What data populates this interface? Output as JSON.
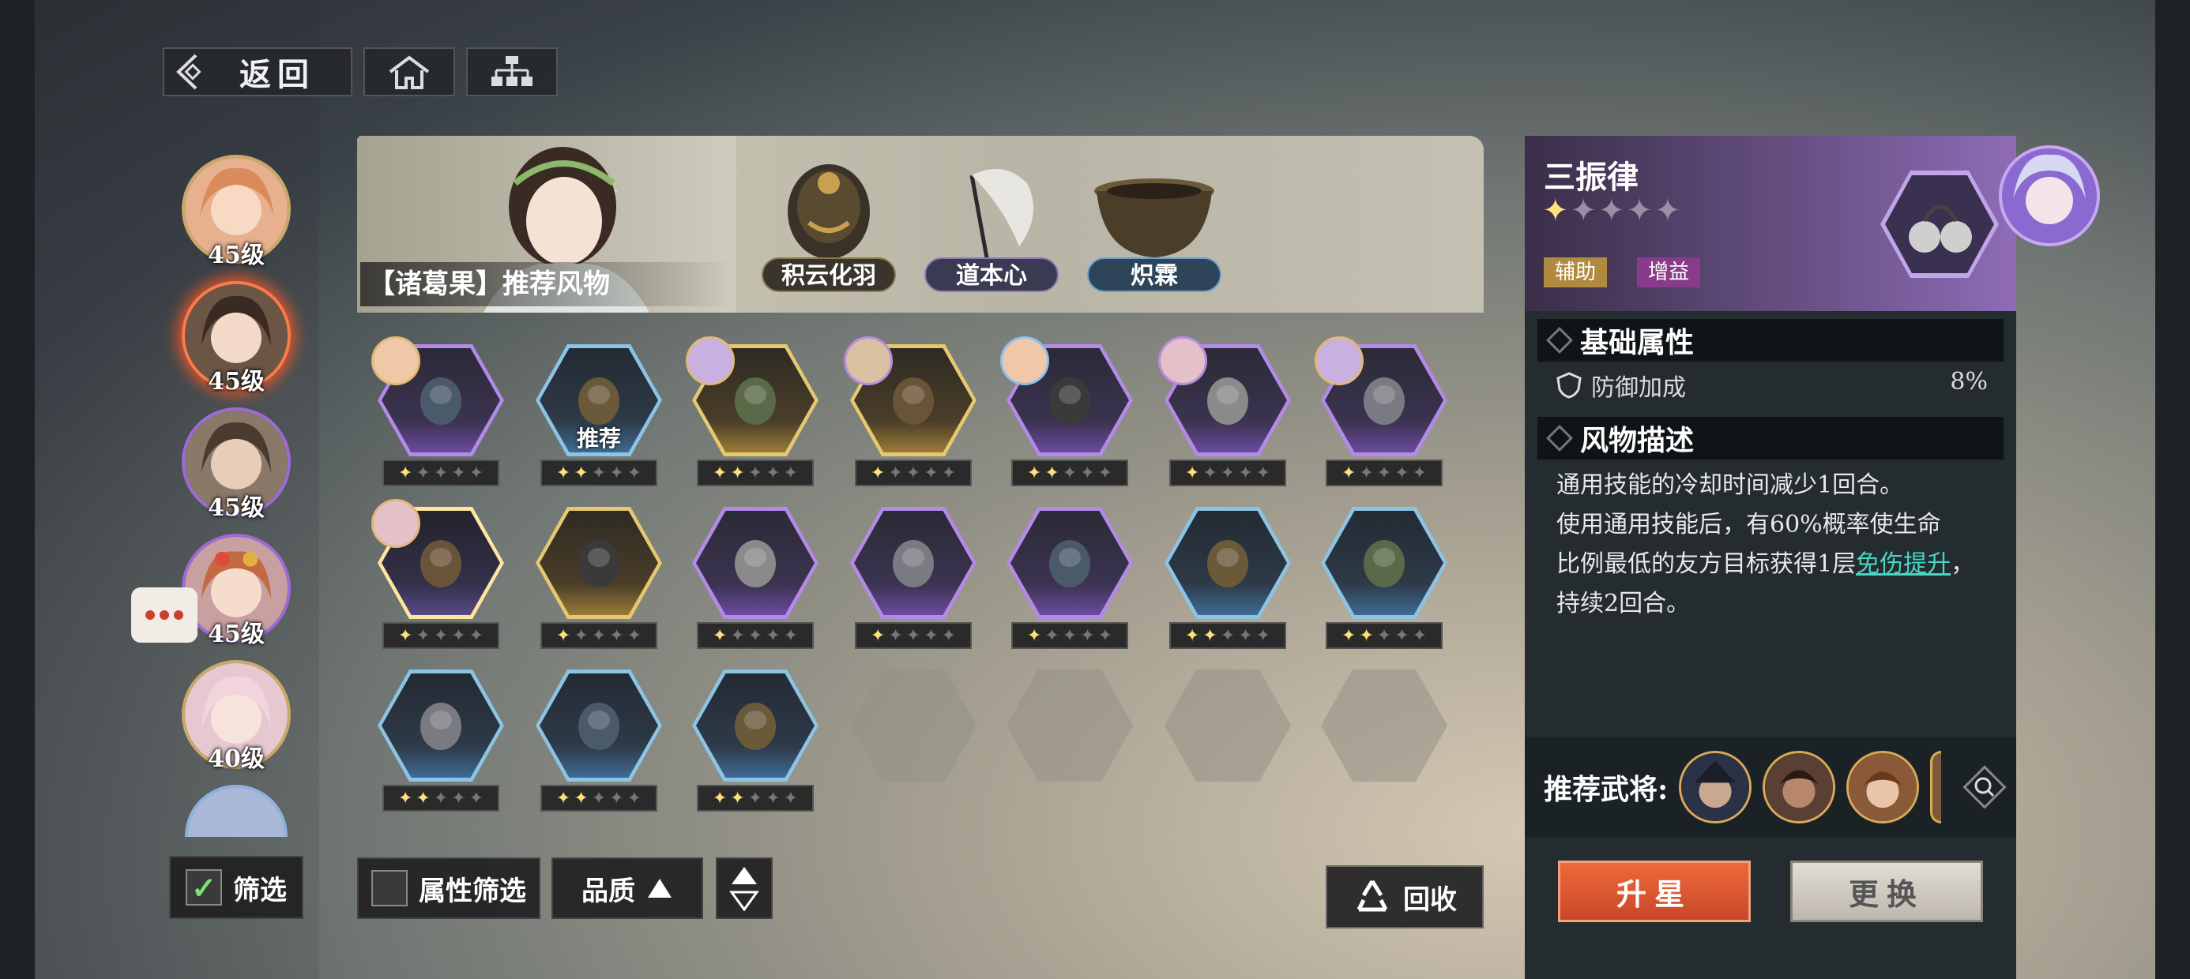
{
  "nav": {
    "back_label": "返回"
  },
  "sidebar": {
    "avatars": [
      {
        "level": "45级"
      },
      {
        "level": "45级"
      },
      {
        "level": "45级"
      },
      {
        "level": "45级"
      },
      {
        "level": "40级"
      }
    ],
    "filter_label": "筛选"
  },
  "banner": {
    "title": "【诸葛果】推荐风物",
    "items": [
      {
        "name": "积云化羽"
      },
      {
        "name": "道本心"
      },
      {
        "name": "炽霖"
      }
    ]
  },
  "grid": {
    "recommend_label": "推荐",
    "rows": [
      [
        {
          "rarity": "purple",
          "stars": 1,
          "badge": true
        },
        {
          "rarity": "blue",
          "stars": 2,
          "recommended": true
        },
        {
          "rarity": "gold",
          "stars": 2,
          "badge": true
        },
        {
          "rarity": "gold",
          "stars": 1,
          "badge": true
        },
        {
          "rarity": "purple",
          "stars": 2,
          "badge": true
        },
        {
          "rarity": "purple",
          "stars": 1,
          "badge": true
        },
        {
          "rarity": "purple",
          "stars": 1,
          "badge": true
        }
      ],
      [
        {
          "rarity": "selected",
          "stars": 1,
          "badge": true
        },
        {
          "rarity": "gold",
          "stars": 1
        },
        {
          "rarity": "purple",
          "stars": 1
        },
        {
          "rarity": "purple",
          "stars": 1
        },
        {
          "rarity": "purple",
          "stars": 1
        },
        {
          "rarity": "blue",
          "stars": 2
        },
        {
          "rarity": "blue",
          "stars": 2
        }
      ],
      [
        {
          "rarity": "blue",
          "stars": 2
        },
        {
          "rarity": "blue",
          "stars": 2
        },
        {
          "rarity": "blue",
          "stars": 2
        },
        {
          "rarity": "empty"
        },
        {
          "rarity": "empty"
        },
        {
          "rarity": "empty"
        },
        {
          "rarity": "empty"
        }
      ]
    ]
  },
  "toolbar": {
    "attr_filter_label": "属性筛选",
    "quality_label": "品质",
    "recycle_label": "回收"
  },
  "detail": {
    "name": "三振律",
    "stars": 1,
    "max_stars": 5,
    "tags": [
      "辅助",
      "增益"
    ],
    "base_attr_title": "基础属性",
    "attributes": [
      {
        "name": "防御加成",
        "value": "8%"
      }
    ],
    "desc_title": "风物描述",
    "desc_line1": "通用技能的冷却时间减少1回合。",
    "desc_line2": "使用通用技能后，有60%概率使生命",
    "desc_line3_prefix": "比例最低的友方目标获得1层",
    "desc_link": "免伤提升",
    "desc_suffix": "，持续2回合。",
    "rec_generals_label": "推荐武将:",
    "upgrade_label": "升星",
    "replace_label": "更换"
  },
  "colors": {
    "accent_orange": "#e05a34",
    "link": "#46d6c4",
    "star": "#ffe07a"
  }
}
